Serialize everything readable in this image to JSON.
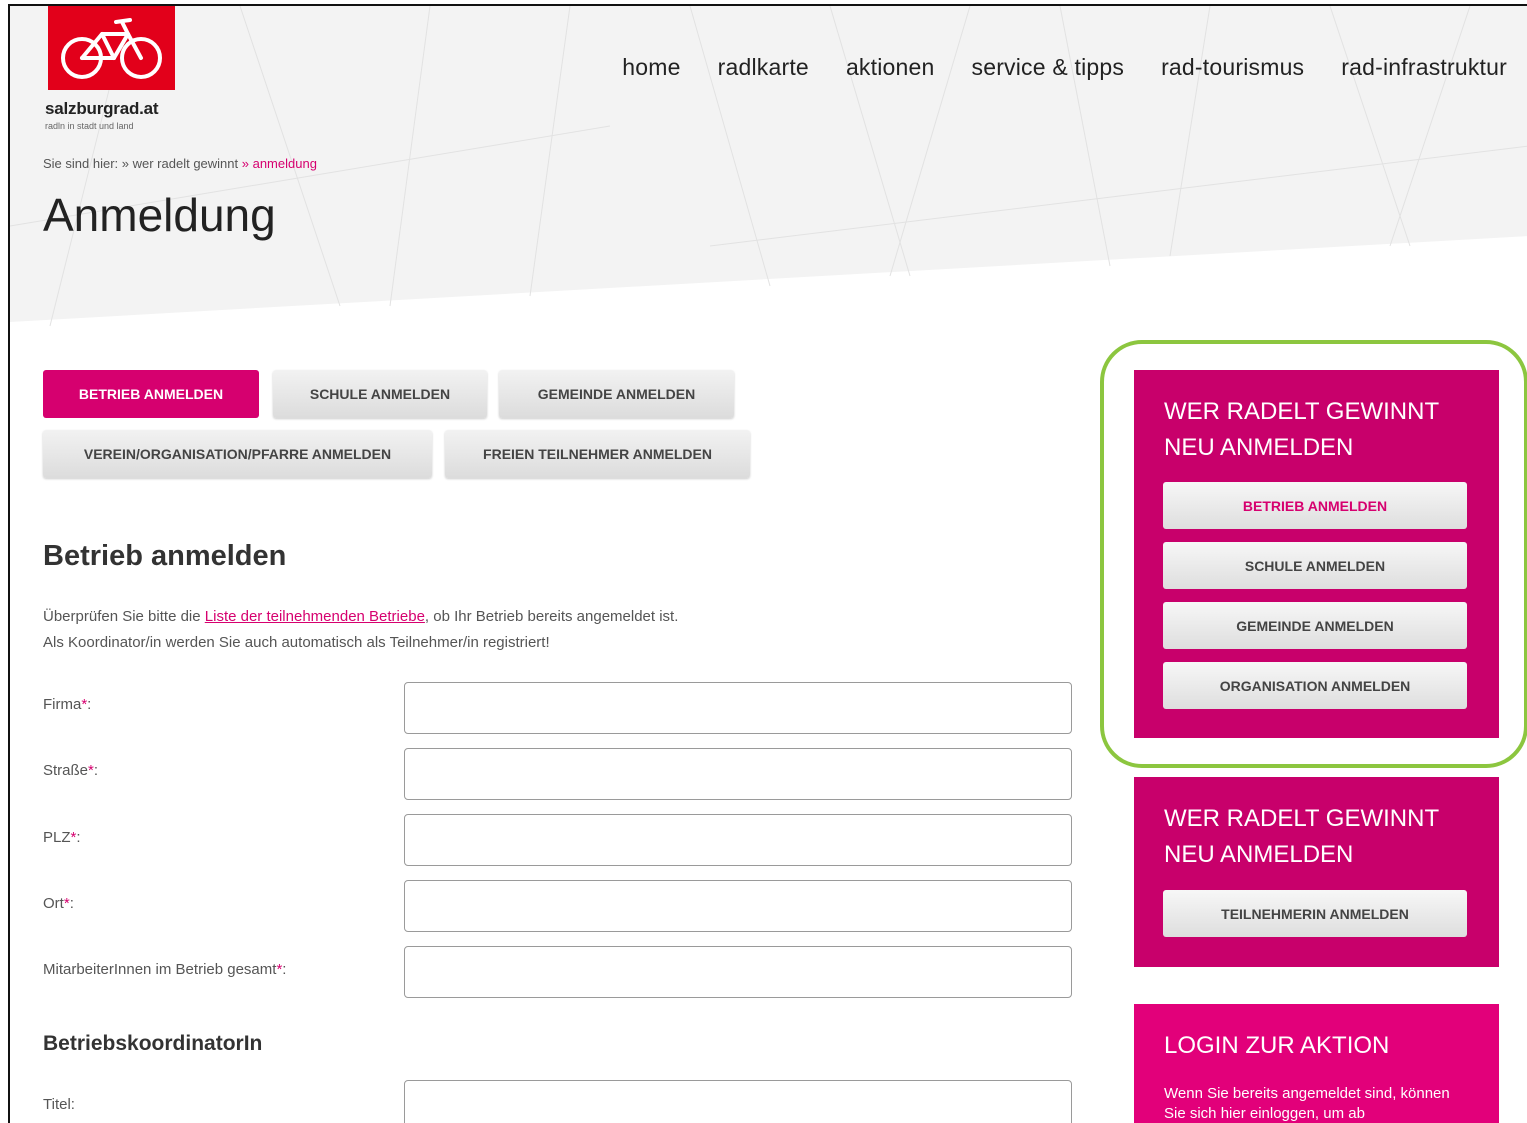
{
  "brand": {
    "name": "salzburgrad.at",
    "tagline": "radln in stadt und land",
    "color": "#e2001a"
  },
  "nav": [
    "home",
    "radlkarte",
    "aktionen",
    "service & tipps",
    "rad-tourismus",
    "rad-infrastruktur"
  ],
  "breadcrumb": {
    "prefix": "Sie sind hier:",
    "items": [
      "» wer radelt gewinnt",
      "» anmeldung"
    ]
  },
  "page_title": "Anmeldung",
  "tabs": [
    {
      "label": "BETRIEB ANMELDEN",
      "active": true
    },
    {
      "label": "SCHULE ANMELDEN",
      "active": false
    },
    {
      "label": "GEMEINDE ANMELDEN",
      "active": false
    },
    {
      "label": "VEREIN/ORGANISATION/PFARRE ANMELDEN",
      "active": false
    },
    {
      "label": "FREIEN TEILNEHMER ANMELDEN",
      "active": false
    }
  ],
  "section": {
    "title": "Betrieb anmelden",
    "intro_before_link": "Überprüfen Sie bitte die ",
    "intro_link": "Liste der teilnehmenden Betriebe",
    "intro_after_link": ", ob Ihr Betrieb bereits angemeldet ist.",
    "intro_line2": "Als Koordinator/in werden Sie auch automatisch als Teilnehmer/in registriert!"
  },
  "form": {
    "fields": [
      {
        "label": "Firma",
        "required": "*",
        "suffix": ":",
        "value": ""
      },
      {
        "label": "Straße",
        "required": "*",
        "suffix": ":",
        "value": ""
      },
      {
        "label": "PLZ",
        "required": "*",
        "suffix": ":",
        "value": ""
      },
      {
        "label": "Ort",
        "required": "*",
        "suffix": ":",
        "value": ""
      },
      {
        "label": "MitarbeiterInnen im Betrieb gesamt",
        "required": "*",
        "suffix": ":",
        "value": ""
      }
    ],
    "coordinator_title": "BetriebskoordinatorIn",
    "coordinator_fields": [
      {
        "label": "Titel:",
        "value": ""
      }
    ]
  },
  "sidebar": {
    "box1": {
      "title_line1": "WER RADELT GEWINNT",
      "title_line2": "NEU ANMELDEN",
      "buttons": [
        {
          "label": "BETRIEB ANMELDEN",
          "active": true
        },
        {
          "label": "SCHULE ANMELDEN",
          "active": false
        },
        {
          "label": "GEMEINDE ANMELDEN",
          "active": false
        },
        {
          "label": "ORGANISATION ANMELDEN",
          "active": false
        }
      ]
    },
    "box2": {
      "title_line1": "WER RADELT GEWINNT",
      "title_line2": "NEU ANMELDEN",
      "buttons": [
        {
          "label": "TEILNEHMERIN ANMELDEN",
          "active": false
        }
      ]
    },
    "login": {
      "title": "LOGIN ZUR AKTION",
      "text": "Wenn Sie bereits angemeldet sind, können Sie sich hier einloggen, um ab"
    }
  },
  "colors": {
    "accent": "#d6006f",
    "sidebar": "#c8006b",
    "login": "#e2007a",
    "highlight": "#8cc63f"
  },
  "icons": [
    "bicycle-icon"
  ]
}
